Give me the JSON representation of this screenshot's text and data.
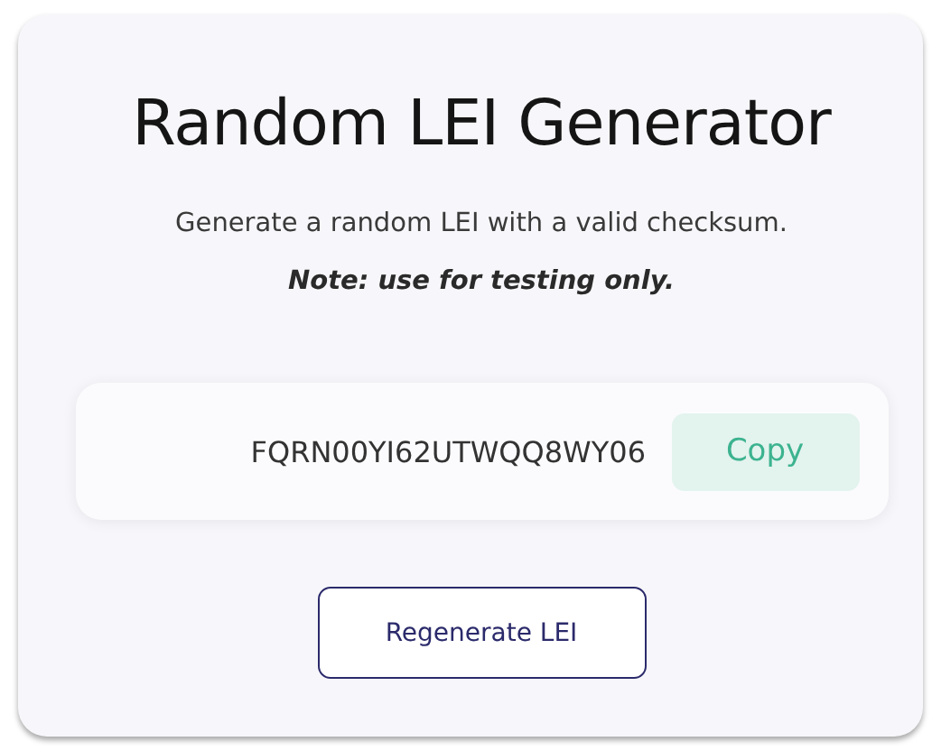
{
  "title": "Random LEI Generator",
  "description": "Generate a random LEI with a valid checksum.",
  "note": "Note: use for testing only.",
  "result": {
    "value": "FQRN00YI62UTWQQ8WY06",
    "copy_button": "Copy"
  },
  "regenerate_button": "Regenerate LEI"
}
